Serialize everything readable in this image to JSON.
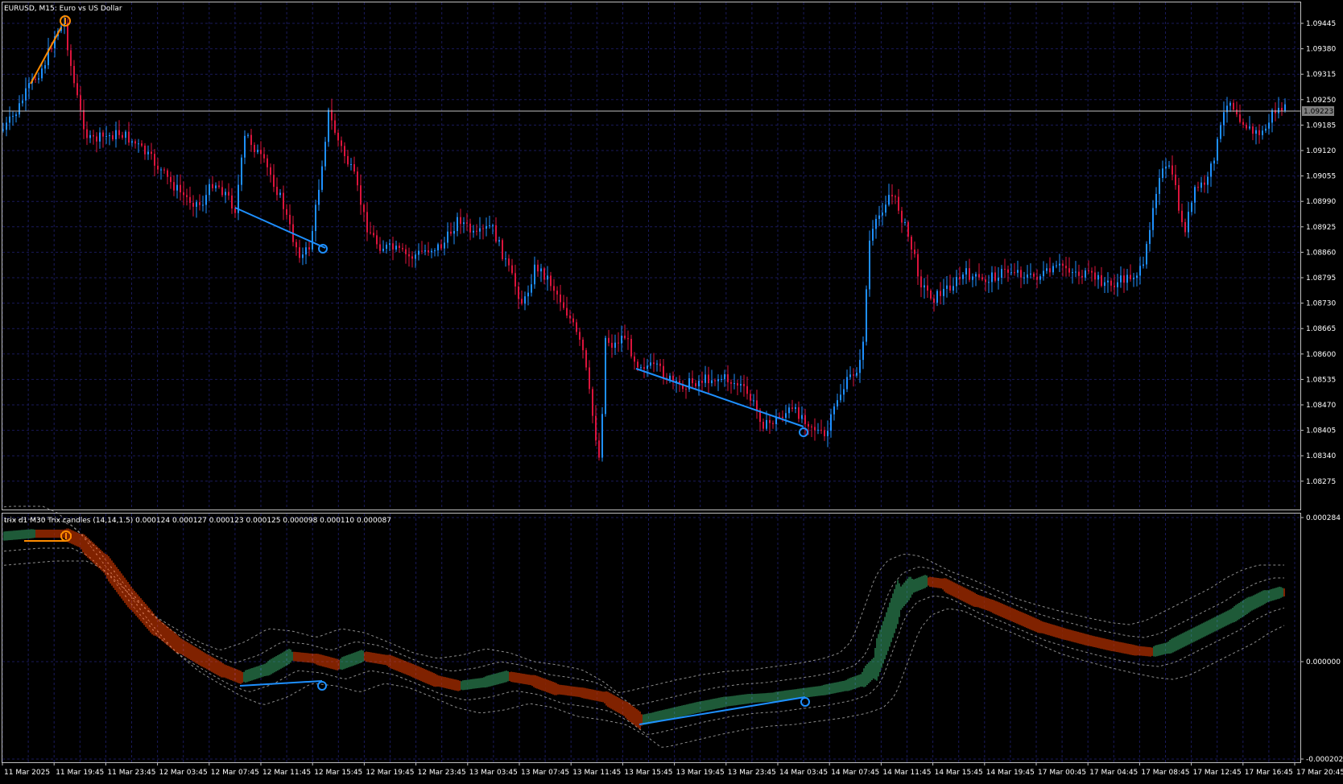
{
  "main_panel": {
    "title": "EURUSD, M15:  Euro vs US Dollar",
    "current_price": "1.09223",
    "price_labels": [
      "1.09445",
      "1.09380",
      "1.09315",
      "1.09250",
      "1.09185",
      "1.09120",
      "1.09055",
      "1.08990",
      "1.08925",
      "1.08860",
      "1.08795",
      "1.08730",
      "1.08665",
      "1.08600",
      "1.08535",
      "1.08470",
      "1.08405",
      "1.08340",
      "1.08275"
    ]
  },
  "sub_panel": {
    "title": "trix d1 M30 Trix candles (14,14,1.5) 0.000124 0.000127 0.000123 0.000125 0.000098 0.000110 0.000087",
    "scale_labels": [
      "0.000284",
      "0.000000",
      "-0.000202"
    ]
  },
  "time_axis": {
    "labels": [
      "11 Mar 2025",
      "11 Mar 19:45",
      "11 Mar 23:45",
      "12 Mar 03:45",
      "12 Mar 07:45",
      "12 Mar 11:45",
      "12 Mar 15:45",
      "12 Mar 19:45",
      "12 Mar 23:45",
      "13 Mar 03:45",
      "13 Mar 07:45",
      "13 Mar 11:45",
      "13 Mar 15:45",
      "13 Mar 19:45",
      "13 Mar 23:45",
      "14 Mar 03:45",
      "14 Mar 07:45",
      "14 Mar 11:45",
      "14 Mar 15:45",
      "14 Mar 19:45",
      "17 Mar 00:45",
      "17 Mar 04:45",
      "17 Mar 08:45",
      "17 Mar 12:45",
      "17 Mar 16:45",
      "17 Mar 20:45"
    ]
  },
  "colors": {
    "background": "#000000",
    "grid": "#1a1a5a",
    "frame": "#c0c0c0",
    "bull": "#1e90ff",
    "bear": "#dc143c",
    "trix_up": "#3cb371",
    "trix_down": "#ff4500",
    "divergence": "#1e90ff",
    "divergence_top": "#ff8c00"
  },
  "icons": {
    "bearish_divergence": "arrow-down-icon",
    "bullish_divergence": "arrow-up-icon"
  }
}
